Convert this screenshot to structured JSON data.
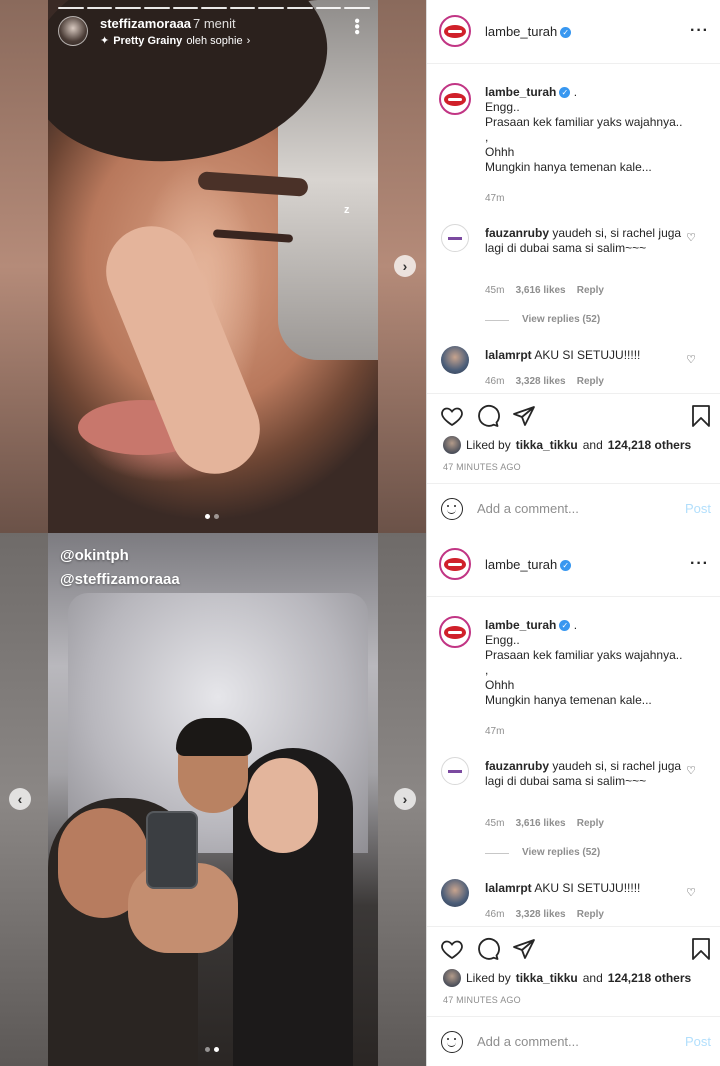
{
  "panels": [
    {
      "story": {
        "username": "steffizamoraaa",
        "time": "7 menit",
        "filter_name": "Pretty Grainy",
        "filter_by": "oleh sophie",
        "overlay_text": "z",
        "mentions": []
      },
      "post": {
        "account": "lambe_turah",
        "caption_user": "lambe_turah",
        "caption_lines": [
          ".",
          "Engg..",
          "Prasaan kek familiar yaks wajahnya..",
          ",",
          "Ohhh",
          "Mungkin hanya temenan kale..."
        ],
        "caption_time": "47m",
        "comments": [
          {
            "user": "fauzanruby",
            "text": "yaudeh si, si rachel juga lagi di dubai sama si salim~~~",
            "time": "45m",
            "likes": "3,616 likes",
            "reply": "Reply",
            "view_replies": "View replies (52)"
          },
          {
            "user": "lalamrpt",
            "text": "AKU SI SETUJU!!!!!",
            "time": "46m",
            "likes": "3,328 likes",
            "reply": "Reply"
          }
        ],
        "liked_prefix": "Liked by",
        "liked_user": "tikka_tikku",
        "liked_and": "and",
        "liked_others": "124,218 others",
        "posted": "47 MINUTES AGO",
        "add_comment_placeholder": "Add a comment...",
        "post_label": "Post"
      }
    },
    {
      "story": {
        "username": "",
        "time": "",
        "filter_name": "",
        "filter_by": "",
        "overlay_text": "",
        "mentions": [
          "@okintph",
          "@steffizamoraaa"
        ]
      },
      "post": {
        "account": "lambe_turah",
        "caption_user": "lambe_turah",
        "caption_lines": [
          ".",
          "Engg..",
          "Prasaan kek familiar yaks wajahnya..",
          ",",
          "Ohhh",
          "Mungkin hanya temenan kale..."
        ],
        "caption_time": "47m",
        "comments": [
          {
            "user": "fauzanruby",
            "text": "yaudeh si, si rachel juga lagi di dubai sama si salim~~~",
            "time": "45m",
            "likes": "3,616 likes",
            "reply": "Reply",
            "view_replies": "View replies (52)"
          },
          {
            "user": "lalamrpt",
            "text": "AKU SI SETUJU!!!!!",
            "time": "46m",
            "likes": "3,328 likes",
            "reply": "Reply"
          }
        ],
        "liked_prefix": "Liked by",
        "liked_user": "tikka_tikku",
        "liked_and": "and",
        "liked_others": "124,218 others",
        "posted": "47 MINUTES AGO",
        "add_comment_placeholder": "Add a comment...",
        "post_label": "Post"
      }
    }
  ],
  "icons": {
    "verified": "verified-badge-icon",
    "lips": "lips-logo-icon",
    "heart": "heart-icon",
    "comment": "comment-icon",
    "share": "send-icon",
    "bookmark": "bookmark-icon",
    "smile": "emoji-icon",
    "chevron_right": "chevron-right-icon",
    "chevron_left": "chevron-left-icon",
    "more": "more-icon",
    "sparkle": "sparkle-icon"
  },
  "colors": {
    "verified": "#3897f0",
    "brand_ring": "#c13584",
    "post_button": "#b2dffc",
    "meta_text": "#8e8e8e"
  }
}
